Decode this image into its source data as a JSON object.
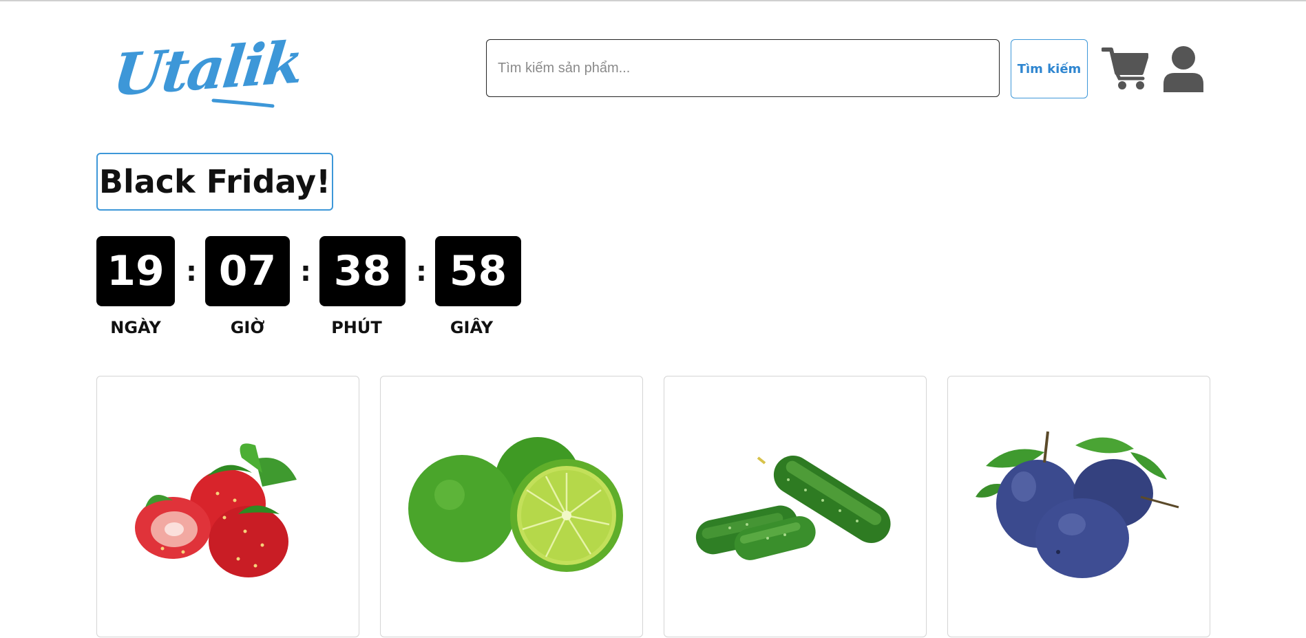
{
  "header": {
    "logo_text": "Utalik",
    "search": {
      "placeholder": "Tìm kiếm sản phẩm...",
      "value": ""
    },
    "search_button_label": "Tìm kiếm",
    "icons": [
      "cart-icon",
      "user-icon"
    ]
  },
  "promo": {
    "title": "Black Friday!",
    "countdown": [
      {
        "value": "19",
        "label": "NGÀY"
      },
      {
        "value": "07",
        "label": "GIỜ"
      },
      {
        "value": "38",
        "label": "PHÚT"
      },
      {
        "value": "58",
        "label": "GIÂY"
      }
    ],
    "separator": ":"
  },
  "products": [
    {
      "image": "strawberries-image"
    },
    {
      "image": "limes-image"
    },
    {
      "image": "cucumbers-image"
    },
    {
      "image": "plums-image"
    }
  ],
  "colors": {
    "accent": "#3d97d8",
    "timer_bg": "#000000",
    "icon_gray": "#555555"
  }
}
